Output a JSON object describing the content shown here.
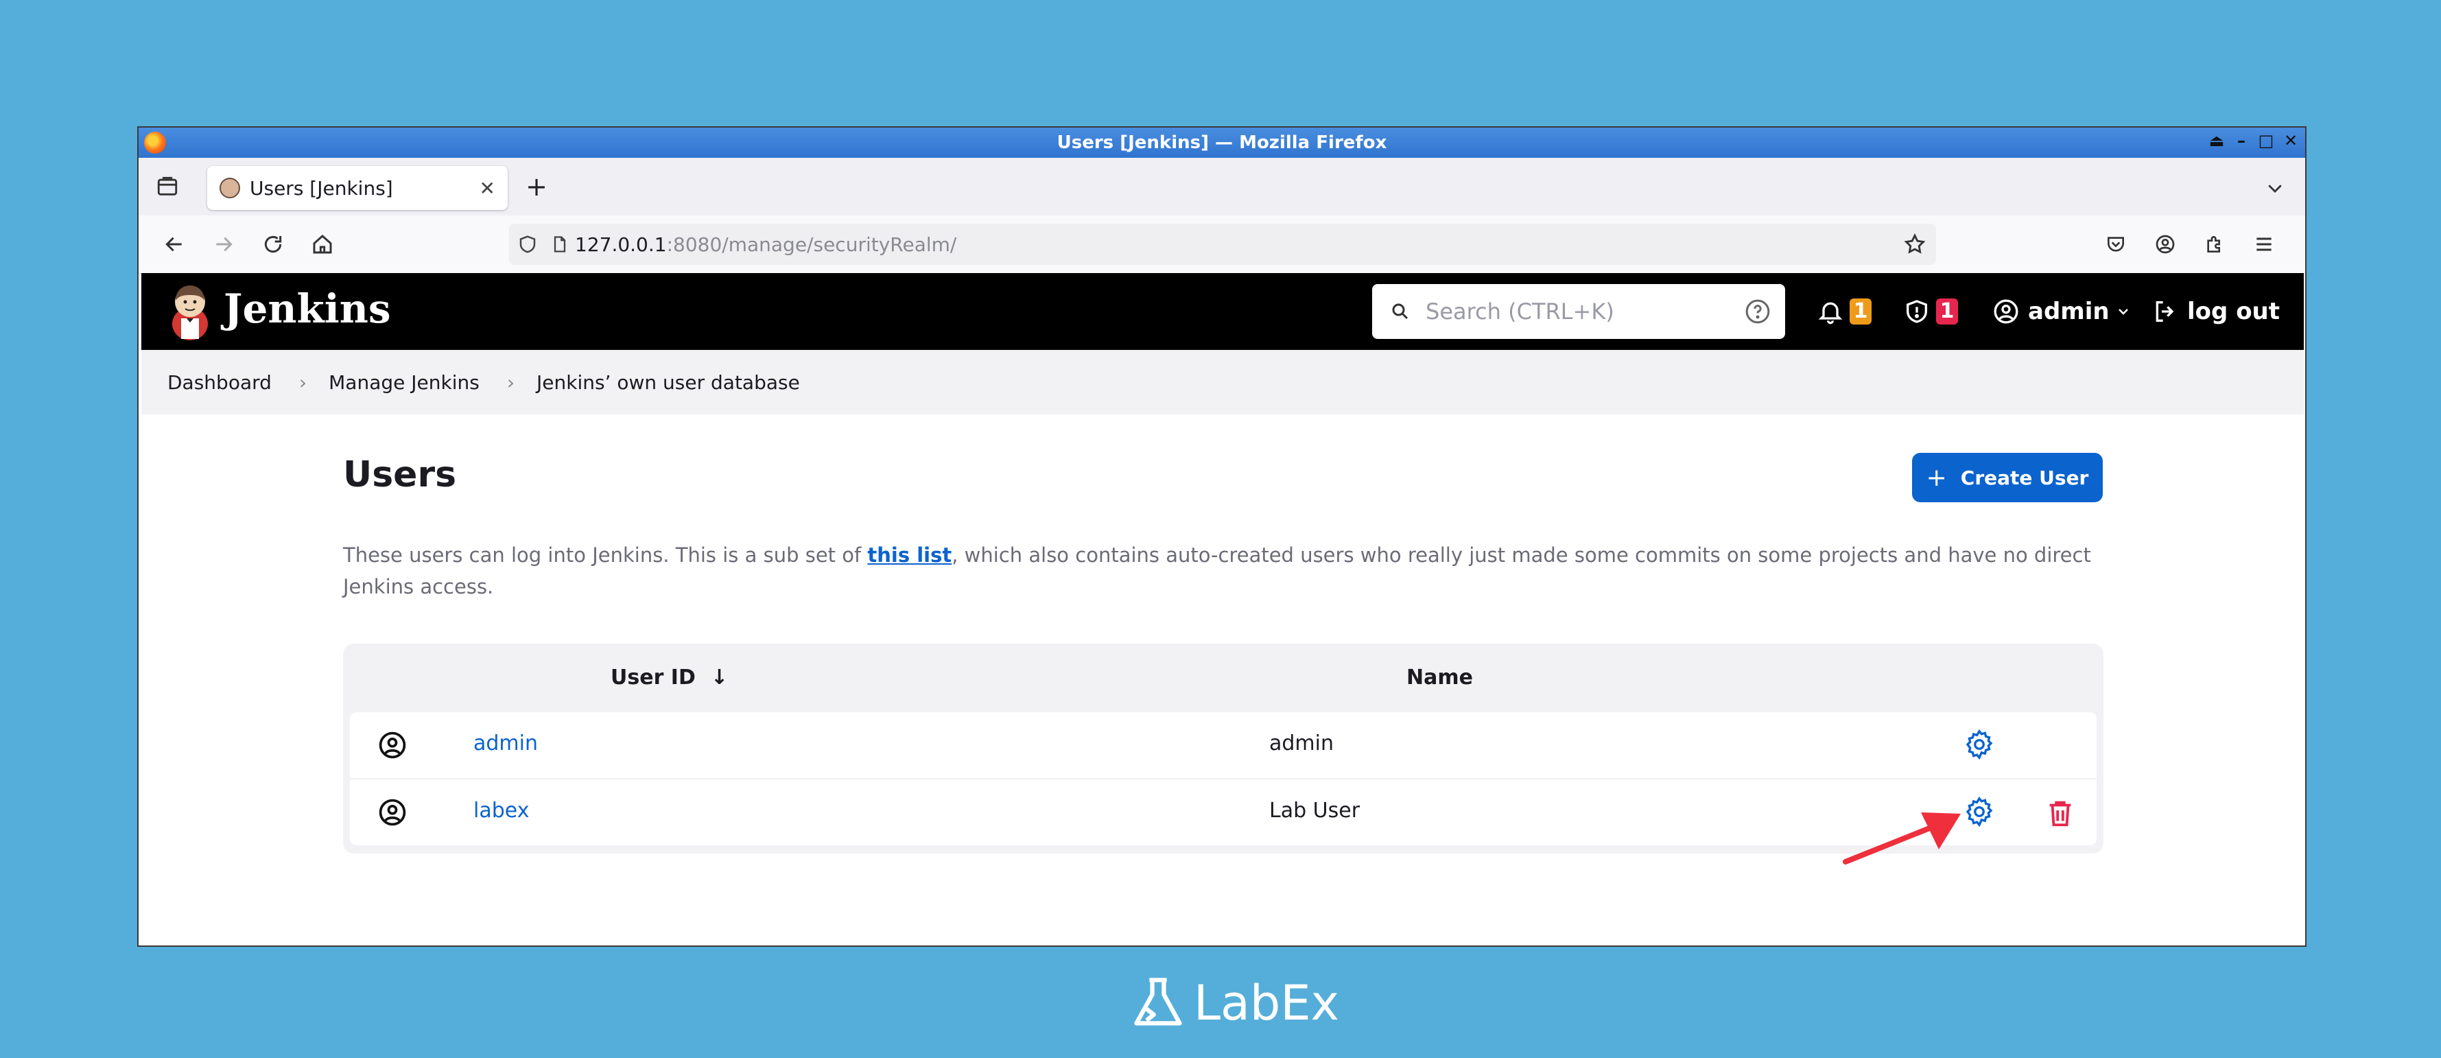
{
  "window": {
    "title": "Users [Jenkins] — Mozilla Firefox"
  },
  "tab": {
    "title": "Users [Jenkins]"
  },
  "url": {
    "host": "127.0.0.1",
    "rest": ":8080/manage/securityRealm/"
  },
  "header": {
    "brand": "Jenkins",
    "search_placeholder": "Search (CTRL+K)",
    "notifications_count": "1",
    "security_count": "1",
    "user": "admin",
    "logout": "log out"
  },
  "breadcrumb": [
    "Dashboard",
    "Manage Jenkins",
    "Jenkins’ own user database"
  ],
  "page": {
    "title": "Users",
    "create_button": "Create User",
    "description_before": "These users can log into Jenkins. This is a sub set of ",
    "description_link": "this list",
    "description_after": ", which also contains auto-created users who really just made some commits on some projects and have no direct Jenkins access."
  },
  "table": {
    "headers": {
      "user_id": "User ID",
      "sort_indicator": "↓",
      "name": "Name"
    },
    "rows": [
      {
        "user_id": "admin",
        "name": "admin"
      },
      {
        "user_id": "labex",
        "name": "Lab User"
      }
    ]
  },
  "footer": {
    "brand": "LabEx"
  },
  "colors": {
    "accent": "#0b63ce",
    "danger": "#e6264e",
    "warning": "#ee9b1c",
    "background": "#55aed9",
    "annotation": "#ef2f3c"
  }
}
